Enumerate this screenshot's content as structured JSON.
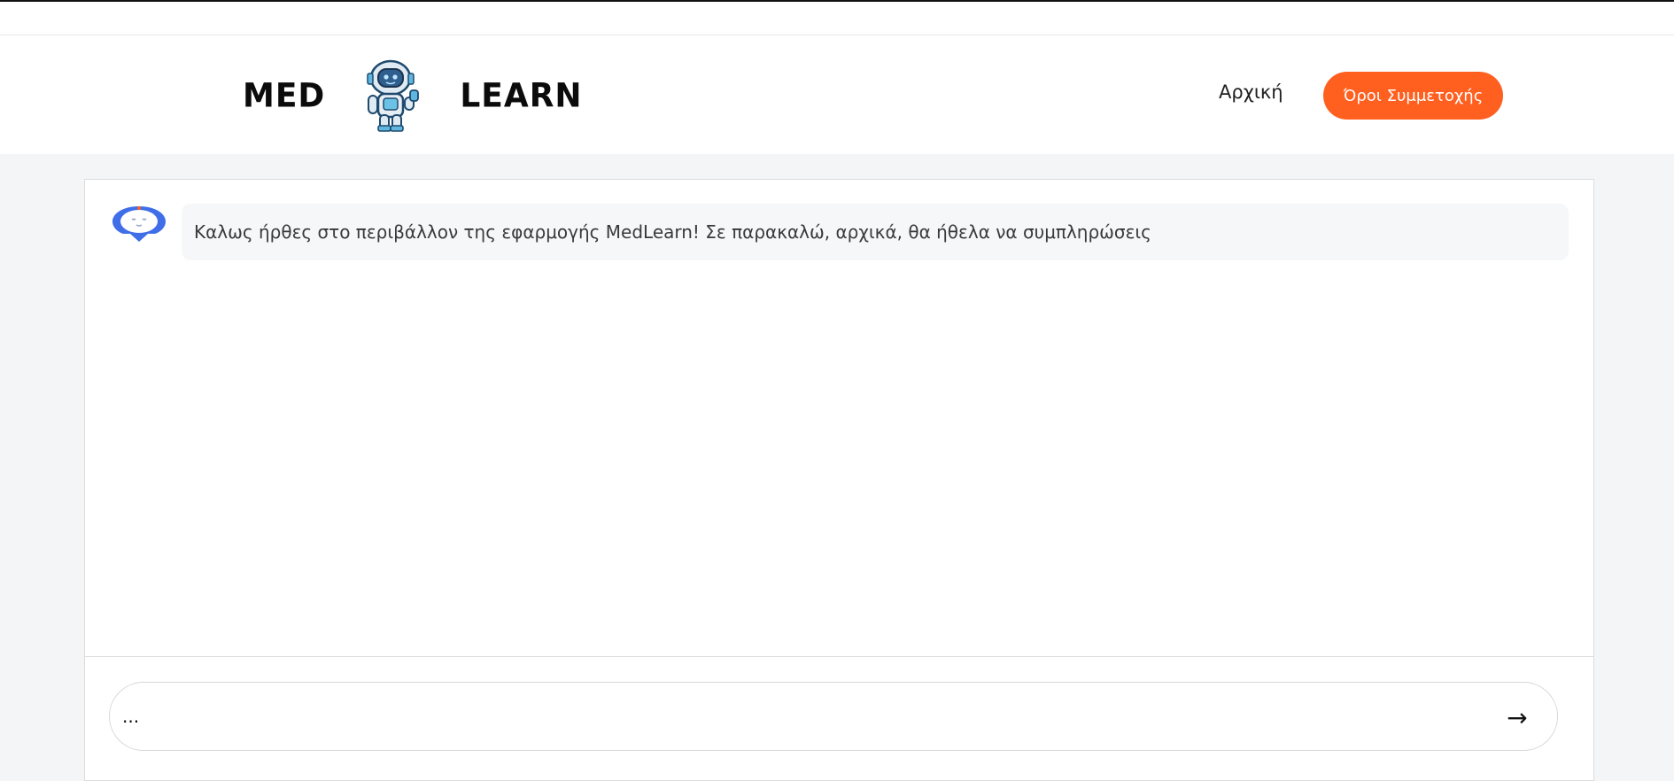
{
  "header": {
    "logo_left": "MED",
    "logo_right": "LEARN",
    "nav_home": "Αρχική",
    "nav_terms": "Όροι Συμμετοχής",
    "accent_color": "#ff5f1f"
  },
  "chat": {
    "bot_icon": "robot-icon",
    "messages": [
      {
        "from": "bot",
        "text": "Καλως ήρθες στο περιβάλλον της εφαρμογής MedLearn! Σε παρακαλώ, αρχικά, θα ήθελα να συμπληρώσεις"
      }
    ],
    "input_value": "...",
    "send_label": "→"
  }
}
